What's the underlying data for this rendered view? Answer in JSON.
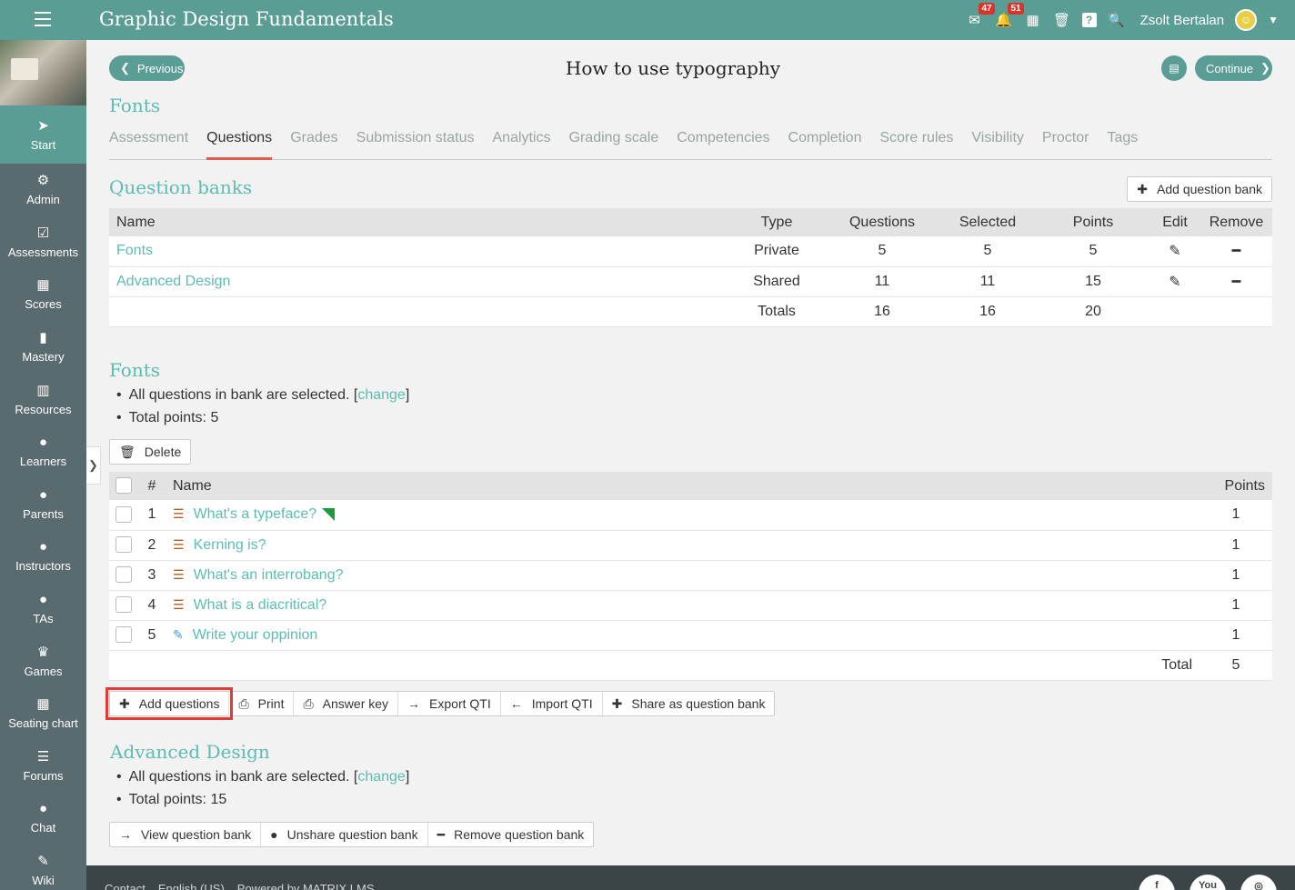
{
  "app": {
    "course_title": "Graphic Design Fundamentals",
    "messages_badge": "47",
    "notifications_badge": "51",
    "user_name": "Zsolt Bertalan"
  },
  "sidebar": {
    "items": [
      {
        "label": "Start",
        "icon": "➤"
      },
      {
        "label": "Admin",
        "icon": "⚙"
      },
      {
        "label": "Assessments",
        "icon": "☑"
      },
      {
        "label": "Scores",
        "icon": "▦"
      },
      {
        "label": "Mastery",
        "icon": "▮"
      },
      {
        "label": "Resources",
        "icon": "▥"
      },
      {
        "label": "Learners",
        "icon": "●"
      },
      {
        "label": "Parents",
        "icon": "●"
      },
      {
        "label": "Instructors",
        "icon": "●"
      },
      {
        "label": "TAs",
        "icon": "●"
      },
      {
        "label": "Games",
        "icon": "♛"
      },
      {
        "label": "Seating chart",
        "icon": "▦"
      },
      {
        "label": "Forums",
        "icon": "☰"
      },
      {
        "label": "Chat",
        "icon": "●"
      },
      {
        "label": "Wiki",
        "icon": "✎"
      }
    ]
  },
  "nav": {
    "previous": "Previous",
    "continue": "Continue",
    "page_title": "How to use typography"
  },
  "section_title": "Fonts",
  "tabs": [
    "Assessment",
    "Questions",
    "Grades",
    "Submission status",
    "Analytics",
    "Grading scale",
    "Competencies",
    "Completion",
    "Score rules",
    "Visibility",
    "Proctor",
    "Tags"
  ],
  "question_banks": {
    "title": "Question banks",
    "add_button": "Add question bank",
    "headers": [
      "Name",
      "Type",
      "Questions",
      "Selected",
      "Points",
      "Edit",
      "Remove"
    ],
    "rows": [
      {
        "name": "Fonts",
        "type": "Private",
        "questions": "5",
        "selected": "5",
        "points": "5"
      },
      {
        "name": "Advanced Design",
        "type": "Shared",
        "questions": "11",
        "selected": "11",
        "points": "15"
      }
    ],
    "totals": {
      "label": "Totals",
      "questions": "16",
      "selected": "16",
      "points": "20"
    }
  },
  "fonts_bank": {
    "title": "Fonts",
    "bullet1_prefix": "All questions in bank are selected. [",
    "bullet1_link": "change",
    "bullet1_suffix": "]",
    "bullet2": "Total points: 5",
    "delete_button": "Delete",
    "headers": {
      "number": "#",
      "name": "Name",
      "points": "Points"
    },
    "questions": [
      {
        "num": "1",
        "name": "What's a typeface?",
        "points": "1"
      },
      {
        "num": "2",
        "name": "Kerning is?",
        "points": "1"
      },
      {
        "num": "3",
        "name": "What's an interrobang?",
        "points": "1"
      },
      {
        "num": "4",
        "name": "What is a diacritical?",
        "points": "1"
      },
      {
        "num": "5",
        "name": "Write your oppinion",
        "points": "1"
      }
    ],
    "total_label": "Total",
    "total_value": "5",
    "actions": [
      "Add questions",
      "Print",
      "Answer key",
      "Export QTI",
      "Import QTI",
      "Share as question bank"
    ]
  },
  "advanced_bank": {
    "title": "Advanced Design",
    "bullet1_prefix": "All questions in bank are selected. [",
    "bullet1_link": "change",
    "bullet1_suffix": "]",
    "bullet2": "Total points: 15",
    "actions": [
      "View question bank",
      "Unshare question bank",
      "Remove question bank"
    ]
  },
  "footer": {
    "links": [
      "Contact",
      "English (US)",
      "Powered by MATRIX LMS"
    ]
  }
}
